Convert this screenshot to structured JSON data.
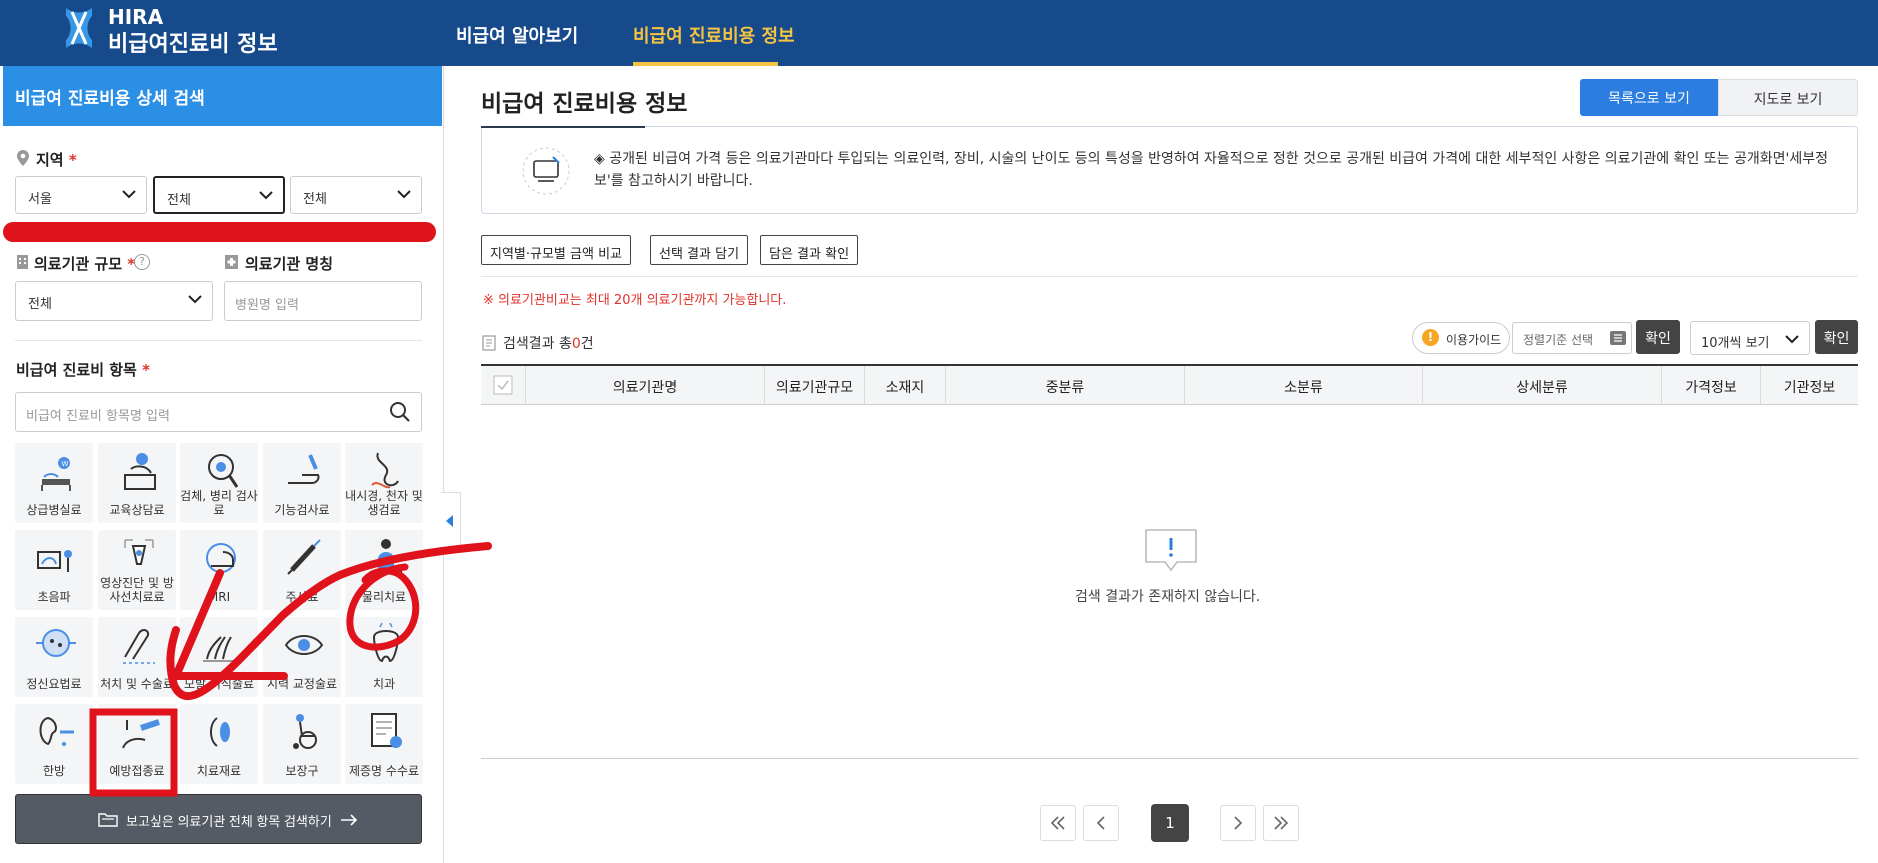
{
  "header": {
    "logo_top": "HIRA",
    "logo_bottom": "비급여진료비 정보",
    "nav": [
      "비급여 알아보기",
      "비급여 진료비용 정보"
    ],
    "brand_color": "#174a8a",
    "active_color": "#f5c342"
  },
  "sidebar": {
    "title": "비급여 진료비용 상세 검색",
    "region": {
      "label": "지역",
      "required_mark": "*",
      "sido": "서울",
      "sigungu": "전체",
      "dong": "전체"
    },
    "scale": {
      "label": "의료기관 규모",
      "required_mark": "*",
      "help": "?",
      "value": "전체"
    },
    "name": {
      "label": "의료기관 명칭",
      "placeholder": "병원명 입력"
    },
    "items": {
      "label": "비급여 진료비 항목",
      "required_mark": "*",
      "placeholder": "비급여 진료비 항목명 입력",
      "categories": [
        "상급병실료",
        "교육상담료",
        "검체, 병리 검사료",
        "기능검사료",
        "내시경, 천자 및 생검료",
        "초음파",
        "영상진단 및 방사선치료료",
        "MRI",
        "주사료",
        "물리치료",
        "정신요법료",
        "처치 및 수술료",
        "모발 이식술료",
        "시력 교정술료",
        "치과",
        "한방",
        "예방접종료",
        "치료재료",
        "보장구",
        "제증명 수수료"
      ]
    },
    "search_all_label": "보고싶은 의료기관 전체 항목 검색하기"
  },
  "main": {
    "title": "비급여 진료비용 정보",
    "view_list": "목록으로 보기",
    "view_map": "지도로 보기",
    "notice": "◈ 공개된 비급여 가격 등은 의료기관마다 투입되는 의료인력, 장비, 시술의 난이도 등의 특성을 반영하여 자율적으로 정한 것으로 공개된 비급여 가격에 대한 세부적인 사항은 의료기관에 확인 또는 공개화면'세부정보'를 참고하시기 바랍니다.",
    "actions": [
      "지역별·규모별 금액 비교",
      "선택 결과 담기",
      "담은 결과 확인"
    ],
    "warning": "※ 의료기관비교는 최대 20개 의료기관까지 가능합니다.",
    "result_prefix": "검색결과 총",
    "result_count": "0",
    "result_suffix": "건",
    "guide": "이용가이드",
    "sort_placeholder": "정렬기준 선택",
    "confirm": "확인",
    "per_page": "10개씩 보기",
    "columns": [
      "의료기관명",
      "의료기관규모",
      "소재지",
      "중분류",
      "소분류",
      "상세분류",
      "가격정보",
      "기관정보"
    ],
    "empty_message": "검색 결과가 존재하지 않습니다.",
    "current_page": "1"
  }
}
